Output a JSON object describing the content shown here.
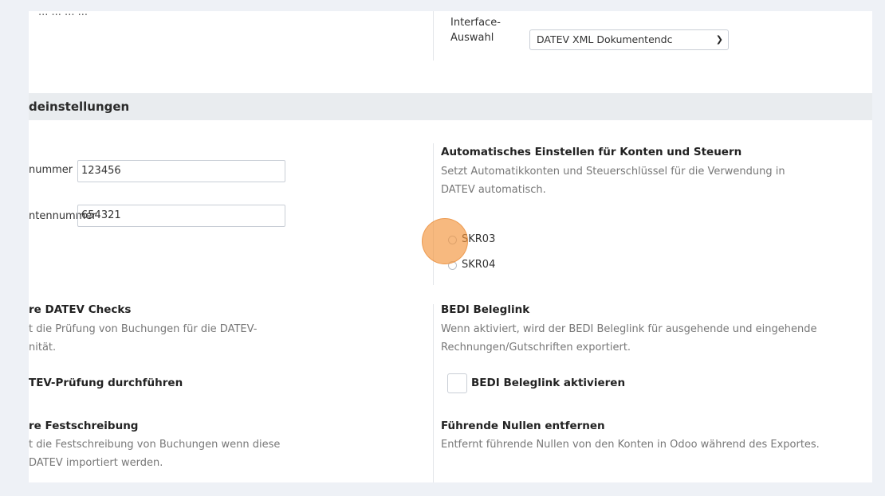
{
  "top": {
    "partial_text": "... ... ... ...",
    "interface_label": "Interface-\nAuswahl",
    "interface_select_value": "DATEV XML Dokumentendc"
  },
  "section": {
    "title": "deinstellungen"
  },
  "fields": {
    "berater_label": "nummer",
    "berater_value": "123456",
    "mandant_label": "ntennummer",
    "mandant_value": "654321"
  },
  "auto": {
    "title": "Automatisches Einstellen für Konten und Steuern",
    "desc": "Setzt Automatikkonten und Steuerschlüssel für die Verwendung in DATEV automatisch.",
    "options": [
      "SKR03",
      "SKR04"
    ]
  },
  "checks": {
    "title": "re DATEV Checks",
    "desc_line1": "t die Prüfung von Buchungen für die DATEV-",
    "desc_line2": "nität.",
    "option_label": "TEV-Prüfung durchführen"
  },
  "bedi": {
    "title": "BEDI Beleglink",
    "desc": "Wenn aktiviert, wird der BEDI Beleglink für ausgehende und eingehende Rechnungen/Gutschriften exportiert.",
    "checkbox_label": "BEDI Beleglink aktivieren"
  },
  "festschreibung": {
    "title": "re Festschreibung",
    "desc_line1": "t die Festschreibung von Buchungen wenn diese",
    "desc_line2": "DATEV importiert werden."
  },
  "nullen": {
    "title": "Führende Nullen entfernen",
    "desc": "Entfernt führende Nullen von den Konten in Odoo während des Exportes."
  },
  "colors": {
    "background": "#eef1f6",
    "panel": "#ffffff",
    "section_bar": "#e9ecef",
    "cursor_highlight": "#f2943a"
  }
}
